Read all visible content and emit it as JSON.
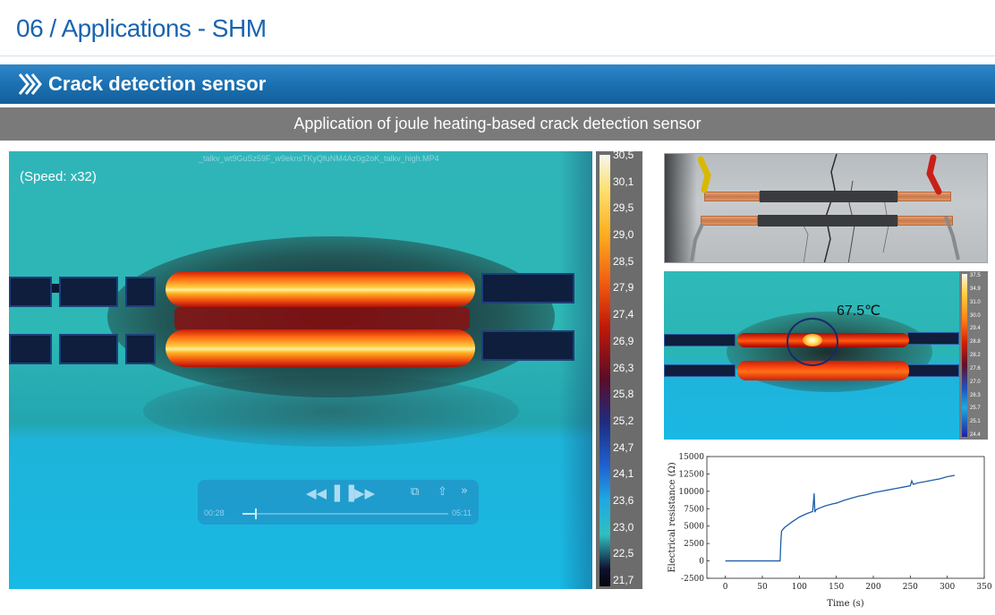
{
  "header": {
    "title": "06 / Applications - SHM"
  },
  "section": {
    "title": "Crack detection sensor"
  },
  "caption": {
    "text": "Application of joule heating-based crack detection sensor"
  },
  "video": {
    "speed_label": "(Speed: x32)",
    "filename": "_talkv_wt9GuSz59F_w9eknsTKyQfuNM4Az0g2oK_talkv_high.MP4",
    "time_elapsed": "00:28",
    "time_total": "05:11",
    "playback_progress": 0.06,
    "controls": {
      "rewind": "◀◀",
      "play_pause": "❚❚",
      "forward": "▶▶",
      "pip": "⧉",
      "share": "⇧",
      "close": "»"
    },
    "colors": {
      "hot": "#ffcc40",
      "cold": "#2fb5b8"
    }
  },
  "color_scale": {
    "ticks": [
      "30,5",
      "30,1",
      "29,5",
      "29,0",
      "28,5",
      "27,9",
      "27,4",
      "26,9",
      "26,3",
      "25,8",
      "25,2",
      "24,7",
      "24,1",
      "23,6",
      "23,0",
      "22,5",
      "21,7"
    ]
  },
  "thermal_inset": {
    "temperature_label": "67.5℃",
    "scale_ticks": [
      "37.5",
      "34.9",
      "31.0",
      "30.0",
      "29.4",
      "28.8",
      "28.2",
      "27.6",
      "27.0",
      "26.3",
      "25.7",
      "25.1",
      "24.4"
    ]
  },
  "chart_data": {
    "type": "line",
    "xlabel": "Time (s)",
    "ylabel": "Electrical resistance (Ω)",
    "xlim": [
      -25,
      350
    ],
    "ylim": [
      -2500,
      15000
    ],
    "xticks": [
      0,
      50,
      100,
      150,
      200,
      250,
      300,
      350
    ],
    "yticks": [
      -2500,
      0,
      2500,
      5000,
      7500,
      10000,
      12500,
      15000
    ],
    "color": "#1f5fa8",
    "series": [
      {
        "x": [
          0,
          20,
          40,
          60,
          74,
          75,
          76,
          80,
          90,
          100,
          110,
          118,
          120,
          121,
          122,
          125,
          135,
          145,
          150,
          160,
          170,
          180,
          190,
          200,
          210,
          220,
          230,
          240,
          250,
          252,
          254,
          260,
          270,
          280,
          290,
          300,
          310
        ],
        "y": [
          0,
          0,
          0,
          0,
          0,
          2800,
          4300,
          4800,
          5600,
          6300,
          6800,
          7100,
          9700,
          7000,
          7300,
          7500,
          7900,
          8200,
          8300,
          8700,
          9000,
          9300,
          9500,
          9800,
          10000,
          10200,
          10400,
          10600,
          10800,
          11500,
          11000,
          11200,
          11400,
          11600,
          11800,
          12100,
          12300
        ]
      }
    ]
  }
}
